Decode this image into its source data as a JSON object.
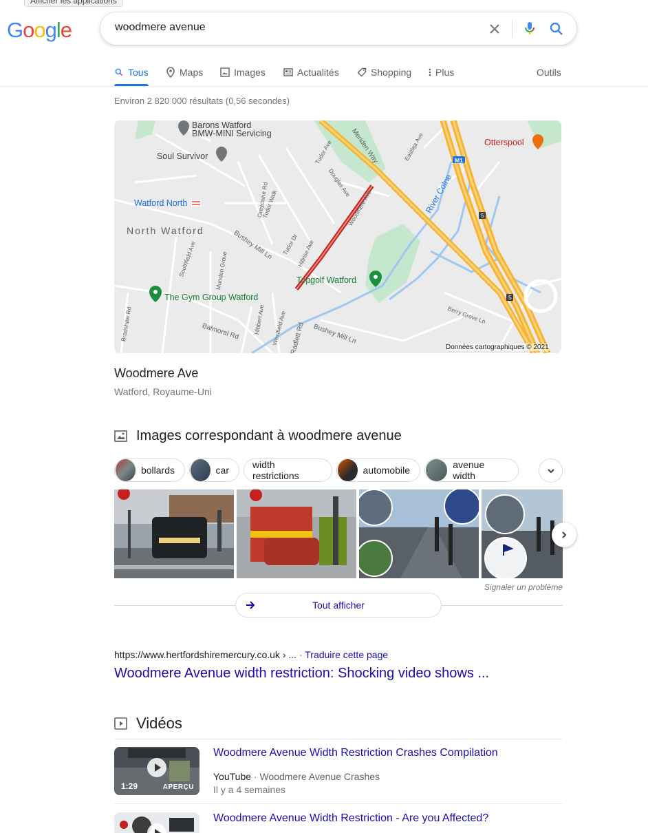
{
  "tooltip": "Afficher les applications",
  "logo": {
    "letters": [
      "G",
      "o",
      "o",
      "g",
      "l",
      "e"
    ],
    "colors": [
      "#4285f4",
      "#ea4335",
      "#fbbc05",
      "#4285f4",
      "#34a853",
      "#ea4335"
    ]
  },
  "search": {
    "query": "woodmere avenue"
  },
  "tabs": {
    "all": "Tous",
    "maps": "Maps",
    "images": "Images",
    "news": "Actualités",
    "shopping": "Shopping",
    "more": "Plus",
    "tools": "Outils"
  },
  "stats": "Environ 2 820 000 résultats (0,56 secondes)",
  "map": {
    "labels": {
      "barons1": "Barons Watford",
      "barons2": "BMW-MINI Servicing",
      "soul": "Soul Survivor",
      "watford_north": "Watford North",
      "north_watford": "North Watford",
      "otterspool": "Otterspool",
      "river": "River Colne",
      "topgolf": "Topgolf Watford",
      "gym": "The Gym Group Watford",
      "bushey1": "Bushey Mill Ln",
      "bushey2": "Bushey Mill Ln",
      "balmoral": "Balmoral Rd",
      "radlett": "Radlett Rd",
      "meriden": "Meriden Way",
      "tudor_ave": "Tudor Ave",
      "douglas": "Douglas Ave",
      "woodmere": "Woodmere Ave",
      "greycaine": "Greycaine Rd",
      "tudor_walk": "Tudor Walk",
      "tudor_dr": "Tudor Dr",
      "hillrise": "Hillrise Ave",
      "southfield": "Southfield Ave",
      "munden": "Munden Grove",
      "hibbert": "Hibbert Ave",
      "westfield": "Westfield Ave",
      "bradshaw": "Bradshaw Rd",
      "berry": "Berry Grove Ln",
      "eastlea": "Eastlea Ave",
      "m1": "M1",
      "j5a": "5",
      "j5b": "5",
      "copyright": "Données cartographiques © 2021"
    }
  },
  "place": {
    "name": "Woodmere Ave",
    "location": "Watford, Royaume-Uni"
  },
  "images_section": {
    "heading": "Images correspondant à woodmere avenue",
    "chips": [
      "bollards",
      "car",
      "width restrictions",
      "automobile",
      "avenue width"
    ],
    "report": "Signaler un problème",
    "show_all": "Tout afficher"
  },
  "result": {
    "cite": "https://www.hertfordshiremercury.co.uk › ...",
    "translate": "Traduire cette page",
    "title": "Woodmere Avenue width restriction: Shocking video shows ..."
  },
  "videos": {
    "heading": "Vidéos",
    "items": [
      {
        "title": "Woodmere Avenue Width Restriction Crashes Compilation",
        "source": "YouTube",
        "channel": "Woodmere Avenue Crashes",
        "age": "Il y a 4 semaines",
        "duration": "1:29",
        "preview": "APERÇU"
      },
      {
        "title": "Woodmere Avenue Width Restriction - Are you Affected?"
      }
    ]
  }
}
